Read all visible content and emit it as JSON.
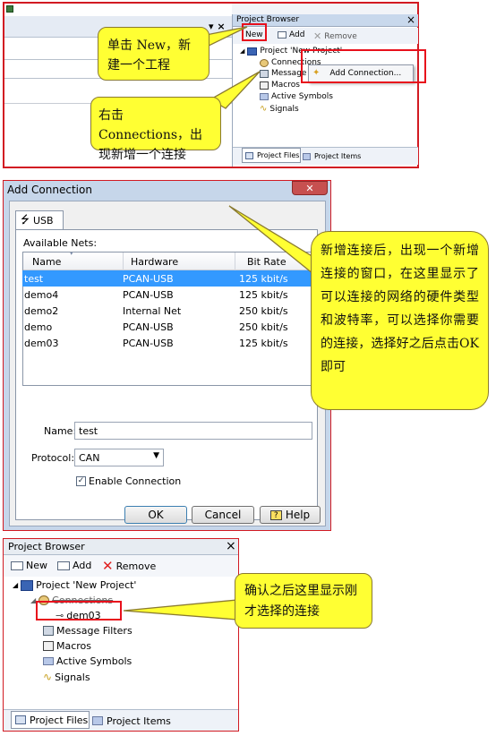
{
  "colors": {
    "callout_fill": "#ffff33",
    "highlight_border": "#e8101c",
    "selection": "#3399ff",
    "titlebar": "#c8d8ec",
    "close_button": "#c75050"
  },
  "panel1": {
    "window_ctrls": "▾ ×",
    "title": "Project Browser",
    "close": "×",
    "toolbar": {
      "new": "New",
      "add": "Add",
      "remove": "Remove"
    },
    "tree": {
      "project": "Project 'New Project'",
      "connections": "Connections",
      "message": "Message",
      "macros": "Macros",
      "active_symbols": "Active Symbols",
      "signals": "Signals"
    },
    "context_menu": {
      "add_connection": "Add Connection..."
    },
    "tabs": {
      "project_files": "Project Files",
      "project_items": "Project Items"
    },
    "callout_new": "单击 New，新建一个工程",
    "callout_right_click": "右击 Connections，出现新增一个连接"
  },
  "dialog": {
    "title": "Add Connection",
    "tab_usb": "USB",
    "available_nets": "Available Nets:",
    "columns": [
      "Name",
      "Hardware",
      "Bit Rate"
    ],
    "rows": [
      [
        "test",
        "PCAN-USB",
        "125 kbit/s"
      ],
      [
        "demo4",
        "PCAN-USB",
        "125 kbit/s"
      ],
      [
        "demo2",
        "Internal Net",
        "250 kbit/s"
      ],
      [
        "demo",
        "PCAN-USB",
        "250 kbit/s"
      ],
      [
        "dem03",
        "PCAN-USB",
        "125 kbit/s"
      ]
    ],
    "name_label": "Name:",
    "name_value": "test",
    "protocol_label": "Protocol:",
    "protocol_value": "CAN",
    "enable_label": "Enable Connection",
    "ok": "OK",
    "cancel": "Cancel",
    "help": "Help",
    "callout": "新增连接后，出现一个新增连接的窗口，在这里显示了可以连接的网络的硬件类型和波特率，可以选择你需要的连接，选择好之后点击OK 即可"
  },
  "panel3": {
    "title": "Project Browser",
    "close": "×",
    "toolbar": {
      "new": "New",
      "add": "Add",
      "remove": "Remove"
    },
    "tree": {
      "project": "Project 'New Project'",
      "connections": "Connections",
      "dem03": "dem03",
      "message_filters": "Message Filters",
      "macros": "Macros",
      "active_symbols": "Active Symbols",
      "signals": "Signals"
    },
    "tabs": {
      "project_files": "Project Files",
      "project_items": "Project Items"
    },
    "callout": "确认之后这里显示刚才选择的连接"
  }
}
